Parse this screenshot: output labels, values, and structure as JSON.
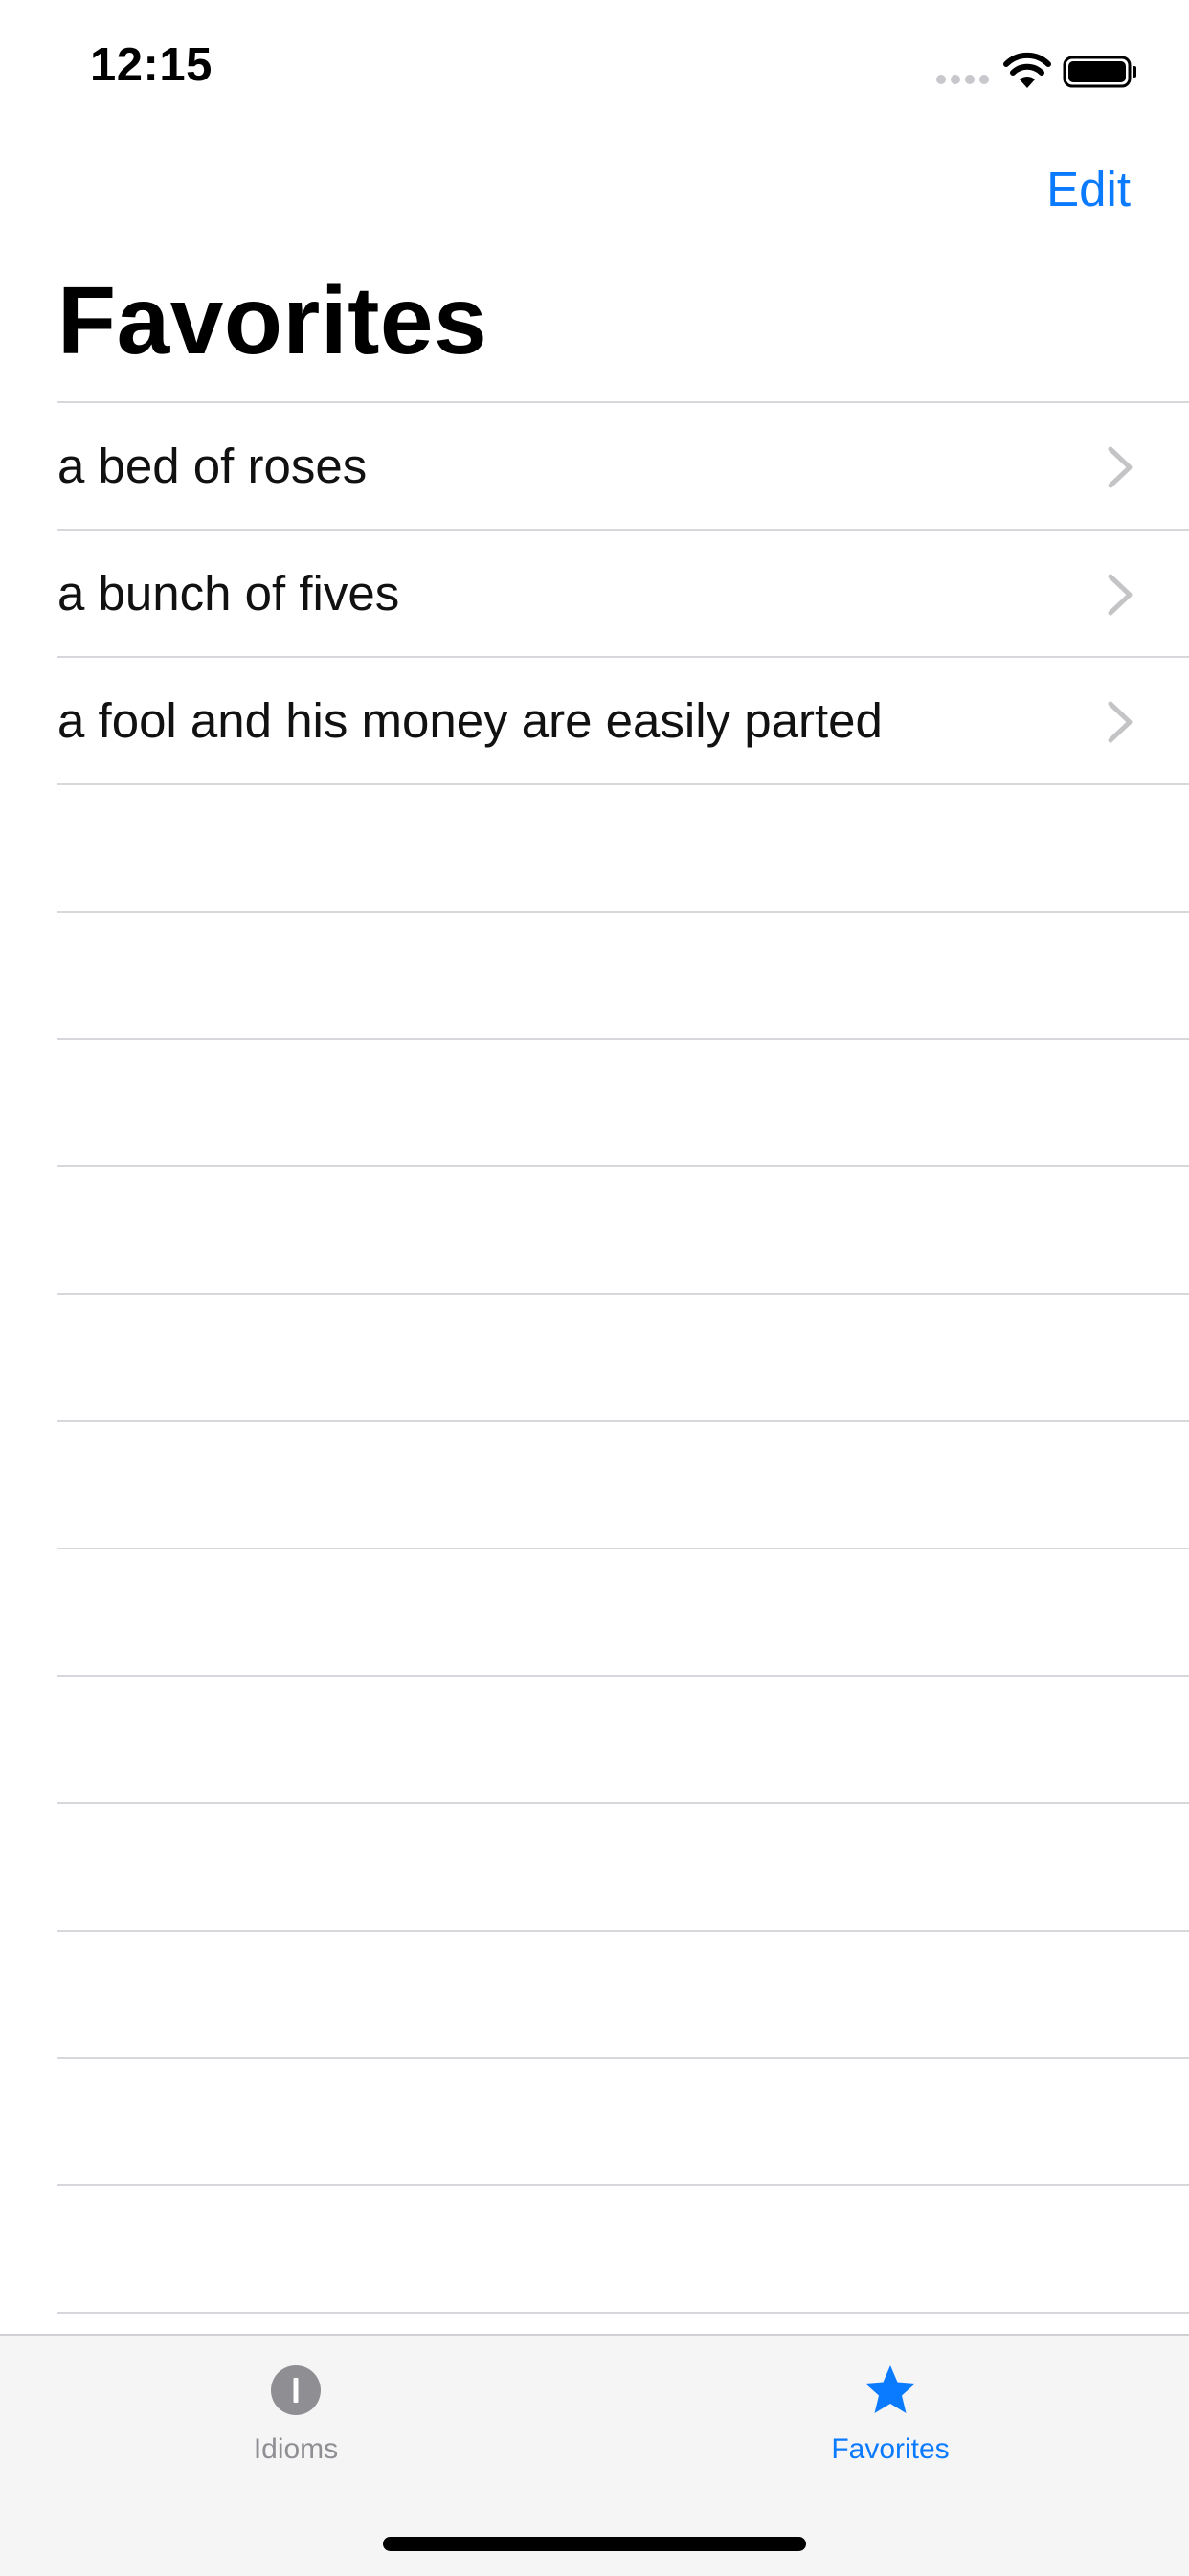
{
  "status_bar": {
    "time": "12:15"
  },
  "nav": {
    "edit_label": "Edit",
    "title": "Favorites"
  },
  "list": {
    "items": [
      {
        "label": "a bed of roses"
      },
      {
        "label": "a bunch of fives"
      },
      {
        "label": "a fool and his money are easily parted"
      }
    ]
  },
  "tab_bar": {
    "tabs": [
      {
        "label": "Idioms",
        "icon": "letter-i-circle-icon",
        "selected": false
      },
      {
        "label": "Favorites",
        "icon": "star-icon",
        "selected": true
      }
    ]
  },
  "colors": {
    "accent": "#0a7aff",
    "separator": "#d8d8dc",
    "inactive_tab": "#8e8e93",
    "chevron": "#c4c4c7"
  }
}
